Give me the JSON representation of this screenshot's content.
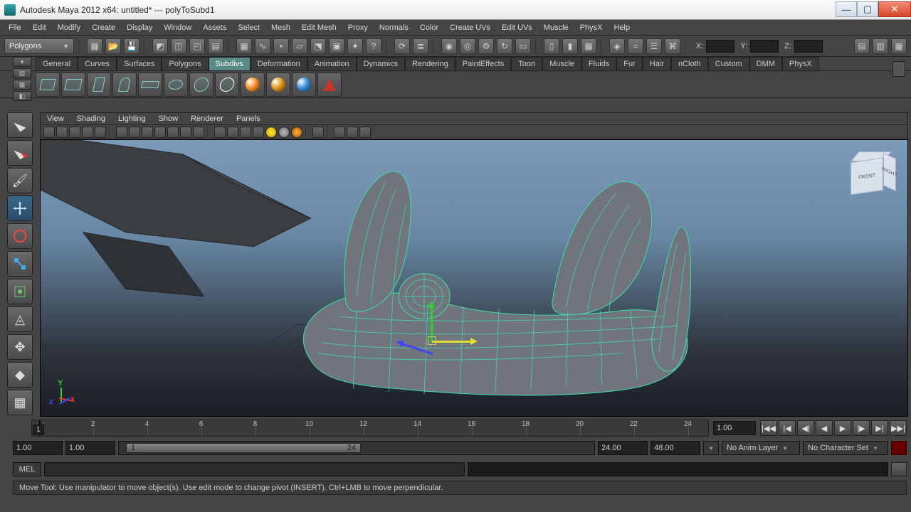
{
  "title": "Autodesk Maya 2012 x64: untitled*  ---  polyToSubd1",
  "menus": [
    "File",
    "Edit",
    "Modify",
    "Create",
    "Display",
    "Window",
    "Assets",
    "Select",
    "Mesh",
    "Edit Mesh",
    "Proxy",
    "Normals",
    "Color",
    "Create UVs",
    "Edit UVs",
    "Muscle",
    "PhysX",
    "Help"
  ],
  "mode": "Polygons",
  "coord": {
    "x": "X:",
    "y": "Y:",
    "z": "Z:",
    "xv": "",
    "yv": "",
    "zv": ""
  },
  "shelf_tabs": [
    "General",
    "Curves",
    "Surfaces",
    "Polygons",
    "Subdivs",
    "Deformation",
    "Animation",
    "Dynamics",
    "Rendering",
    "PaintEffects",
    "Toon",
    "Muscle",
    "Fluids",
    "Fur",
    "Hair",
    "nCloth",
    "Custom",
    "DMM",
    "PhysX"
  ],
  "shelf_active": "Subdivs",
  "panel_menus": [
    "View",
    "Shading",
    "Lighting",
    "Show",
    "Renderer",
    "Panels"
  ],
  "viewcube": {
    "front": "FRONT",
    "right": "RIGHT"
  },
  "timeline": {
    "ticks": [
      2,
      4,
      6,
      8,
      10,
      12,
      14,
      16,
      18,
      20,
      22,
      24
    ],
    "current": "1",
    "end": "1.00"
  },
  "range": {
    "start": "1.00",
    "inner_start": "1.00",
    "bar_start": "1",
    "bar_end": "24",
    "inner_end": "24.00",
    "end": "48.00"
  },
  "anim_layer": "No Anim Layer",
  "char_set": "No Character Set",
  "cmd_label": "MEL",
  "helpline": "Move Tool: Use manipulator to move object(s). Use edit mode to change pivot (INSERT). Ctrl+LMB to move perpendicular."
}
